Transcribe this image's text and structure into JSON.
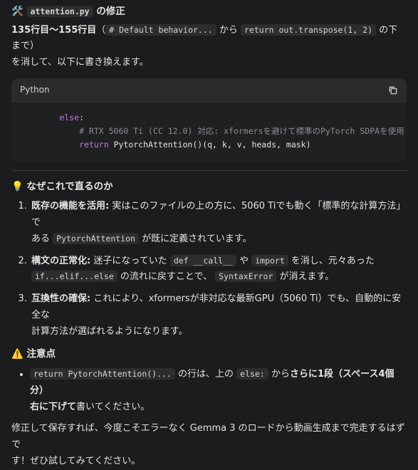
{
  "header": {
    "icon": "tools-icon",
    "file": "attention.py",
    "suffix": "の修正"
  },
  "intro": {
    "lines": "135行目〜155行目",
    "paren_open": "（",
    "code1": "# Default behavior...",
    "kara": "から",
    "code2": "return out.transpose(1, 2)",
    "rest1": "の下まで）",
    "rest2": "を消して、以下に書き換えます。"
  },
  "codeblock": {
    "language": "Python",
    "line1": "else",
    "colon": ":",
    "comment": "# RTX 5060 Ti (CC 12.0) 対応: xformersを避けて標準のPyTorch SDPAを使用",
    "ret": "return",
    "call": "PytorchAttention()(q, k, v, heads, mask)"
  },
  "why": {
    "icon": "lightbulb-icon",
    "title": "なぜこれで直るのか",
    "items": [
      {
        "label": "既存の機能を活用:",
        "t1": "実はこのファイルの上の方に、5060 Tiでも動く「標準的な計算方法」で",
        "t2": "ある",
        "code": "PytorchAttention",
        "t3": "が既に定義されています。"
      },
      {
        "label": "構文の正常化:",
        "t1": "迷子になっていた",
        "code1": "def __call__",
        "t2": "や",
        "code2": "import",
        "t3": "を消し、元々あった",
        "code3": "if...elif...else",
        "t4": "の流れに戻すことで、",
        "code4": "SyntaxError",
        "t5": "が消えます。"
      },
      {
        "label": "互換性の確保:",
        "t1": "これにより、xformersが非対応な最新GPU（5060 Ti）でも、自動的に安全な",
        "t2": "計算方法が選ばれるようになります。"
      }
    ]
  },
  "caution": {
    "icon": "warning-icon",
    "title": "注意点",
    "code1": "return PytorchAttention()...",
    "t1": "の行は、上の",
    "code2": "else:",
    "t2": "から",
    "bold1": "さらに1段（スペース4個分）",
    "bold2": "右に下げて",
    "t3": "書いてください。"
  },
  "outro": {
    "l1": "修正して保存すれば、今度こそエラーなく Gemma 3 のロードから動画生成まで完走するはずで",
    "l2": "す！ぜひ試してみてください。"
  }
}
